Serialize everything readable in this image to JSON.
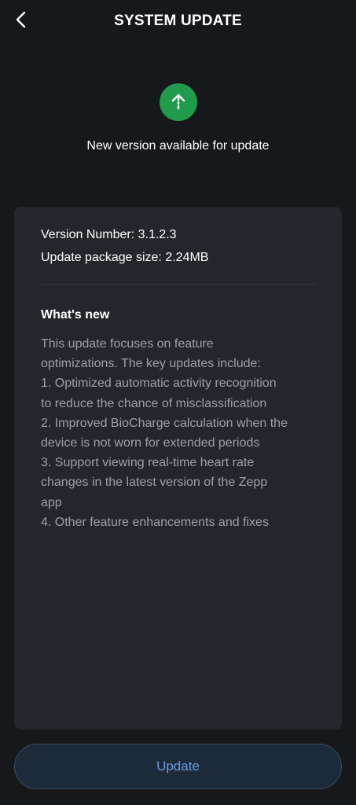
{
  "header": {
    "title": "SYSTEM UPDATE",
    "back_icon": "chevron-left-icon"
  },
  "status": {
    "icon": "upload-arrow-icon",
    "icon_color": "#1f9b4b",
    "text": "New version available for update"
  },
  "details": {
    "version_number": "Version Number: 3.1.2.3",
    "package_size": "Update package size: 2.24MB"
  },
  "whats_new": {
    "title": "What's new",
    "lines": [
      "This update focuses on feature",
      "optimizations. The key updates include:",
      "1. Optimized automatic activity recognition",
      "to reduce the chance of misclassification",
      "2. Improved BioCharge calculation when the",
      "device is not worn for extended periods",
      "3. Support viewing real-time heart rate",
      "changes in the latest version of the Zepp",
      "app",
      "4. Other feature enhancements and fixes"
    ]
  },
  "actions": {
    "update_label": "Update",
    "accent_color": "#6e9ae0"
  }
}
